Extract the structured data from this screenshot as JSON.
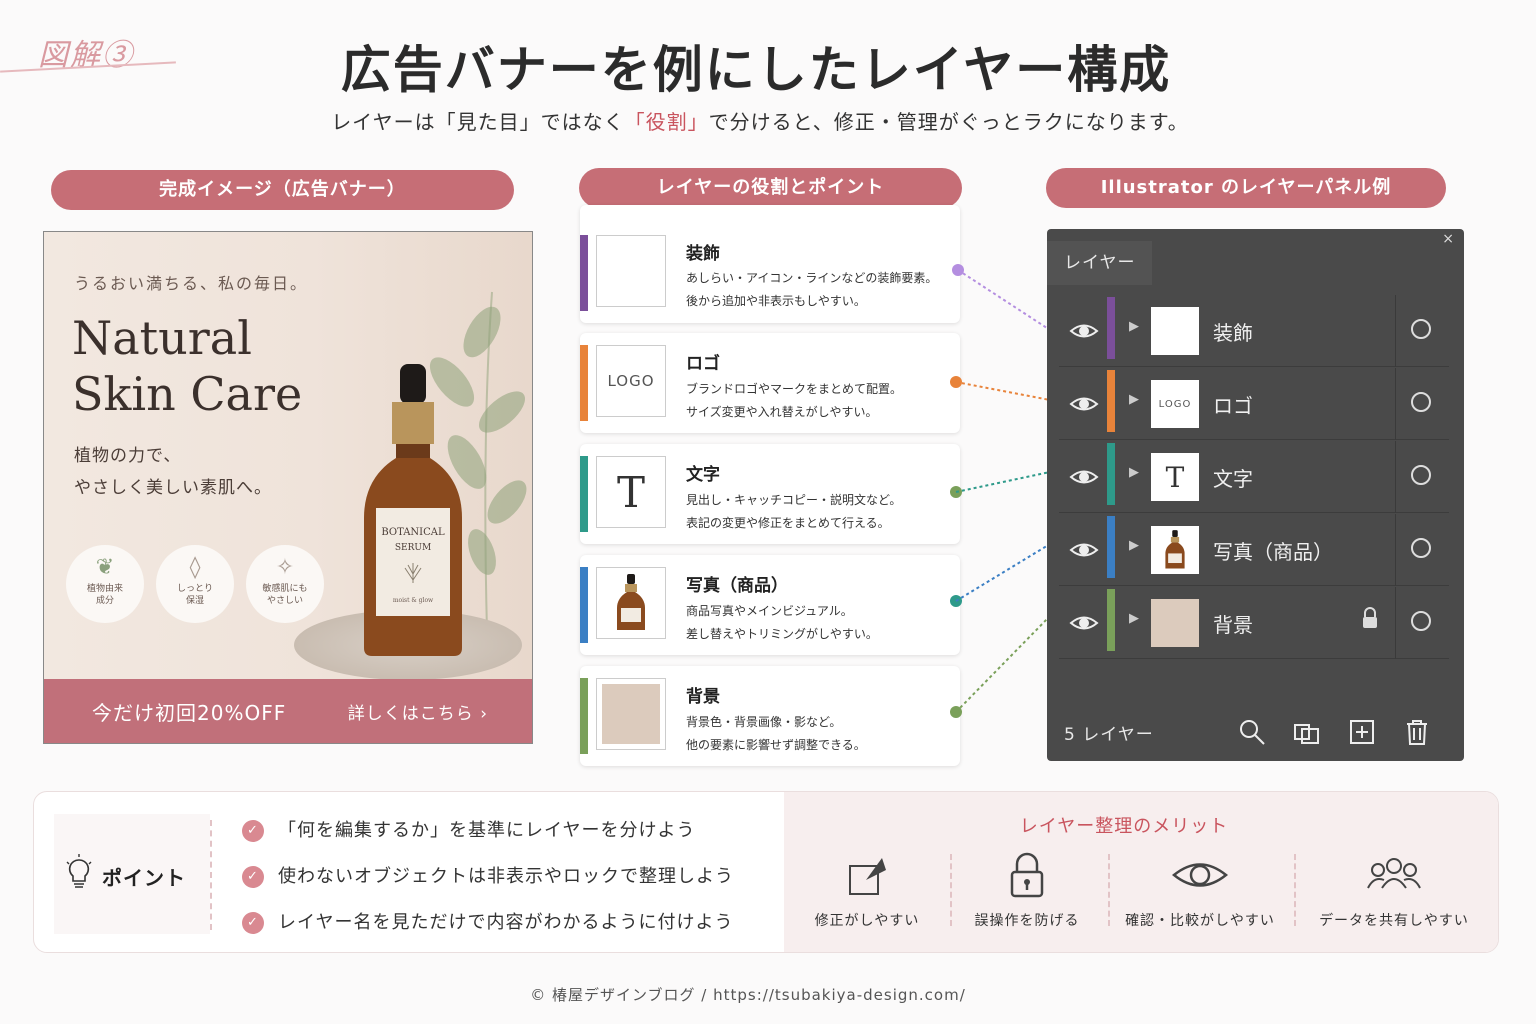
{
  "figure_tag": "図解③",
  "title": "広告バナーを例にしたレイヤー構成",
  "subtitle": {
    "before": "レイヤーは「見た目」ではなく",
    "highlight": "「役割」",
    "after": "で分けると、修正・管理がぐっとラクになります。"
  },
  "sections": {
    "banner_label": "完成イメージ（広告バナー）",
    "roles_label": "レイヤーの役割とポイント",
    "panel_label": "Illustrator のレイヤーパネル例"
  },
  "banner": {
    "tagline": "うるおい満ちる、私の毎日。",
    "headline_1": "Natural",
    "headline_2": "Skin Care",
    "copy_1": "植物の力で、",
    "copy_2": "やさしく美しい素肌へ。",
    "badges": [
      {
        "icon": "leaf-icon",
        "line1": "植物由来",
        "line2": "成分"
      },
      {
        "icon": "drop-icon",
        "line1": "しっとり",
        "line2": "保湿"
      },
      {
        "icon": "sparkle-icon",
        "line1": "敏感肌にも",
        "line2": "やさしい"
      }
    ],
    "bottle_label_1": "BOTANICAL",
    "bottle_label_2": "SERUM",
    "bottle_label_3": "moist & glow",
    "cta": "今だけ初回20%OFF",
    "cta_link": "詳しくはこちら ›"
  },
  "roles": [
    {
      "title": "装飾",
      "desc_1": "あしらい・アイコン・ラインなどの装飾要素。",
      "desc_2": "後から追加や非表示もしやすい。",
      "color": "#7b4f9a"
    },
    {
      "title": "ロゴ",
      "desc_1": "ブランドロゴやマークをまとめて配置。",
      "desc_2": "サイズ変更や入れ替えがしやすい。",
      "color": "#e8833a",
      "thumb_text": "LOGO"
    },
    {
      "title": "文字",
      "desc_1": "見出し・キャッチコピー・説明文など。",
      "desc_2": "表記の変更や修正をまとめて行える。",
      "color": "#2e9a8a",
      "thumb_text": "T"
    },
    {
      "title": "写真（商品）",
      "desc_1": "商品写真やメインビジュアル。",
      "desc_2": "差し替えやトリミングがしやすい。",
      "color": "#3b7fc4"
    },
    {
      "title": "背景",
      "desc_1": "背景色・背景画像・影など。",
      "desc_2": "他の要素に影響せず調整できる。",
      "color": "#7aa05a"
    }
  ],
  "panel": {
    "tab": "レイヤー",
    "close": "×",
    "layers": [
      {
        "name": "装飾",
        "color": "#7b4f9a"
      },
      {
        "name": "ロゴ",
        "color": "#e8833a",
        "thumb_text": "LOGO"
      },
      {
        "name": "文字",
        "color": "#2e9a8a",
        "thumb_text": "T"
      },
      {
        "name": "写真（商品）",
        "color": "#3b7fc4"
      },
      {
        "name": "背景",
        "color": "#7aa05a",
        "locked": true
      }
    ],
    "count": "5 レイヤー",
    "tools": [
      "search-icon",
      "clipping-mask-icon",
      "new-layer-icon",
      "trash-icon"
    ]
  },
  "points": {
    "label": "ポイント",
    "tips": [
      "「何を編集するか」を基準にレイヤーを分けよう",
      "使わないオブジェクトは非表示やロックで整理しよう",
      "レイヤー名を見ただけで内容がわかるように付けよう"
    ]
  },
  "merits": {
    "title": "レイヤー整理のメリット",
    "items": [
      {
        "icon": "edit-icon",
        "label": "修正がしやすい"
      },
      {
        "icon": "lock-icon",
        "label": "誤操作を防げる"
      },
      {
        "icon": "eye-icon",
        "label": "確認・比較がしやすい"
      },
      {
        "icon": "people-icon",
        "label": "データを共有しやすい"
      }
    ]
  },
  "footer": "© 椿屋デザインブログ / https://tsubakiya-design.com/",
  "colors": {
    "accent": "#c66e76",
    "highlight": "#c9545e",
    "panel_bg": "#4a4a4a"
  }
}
